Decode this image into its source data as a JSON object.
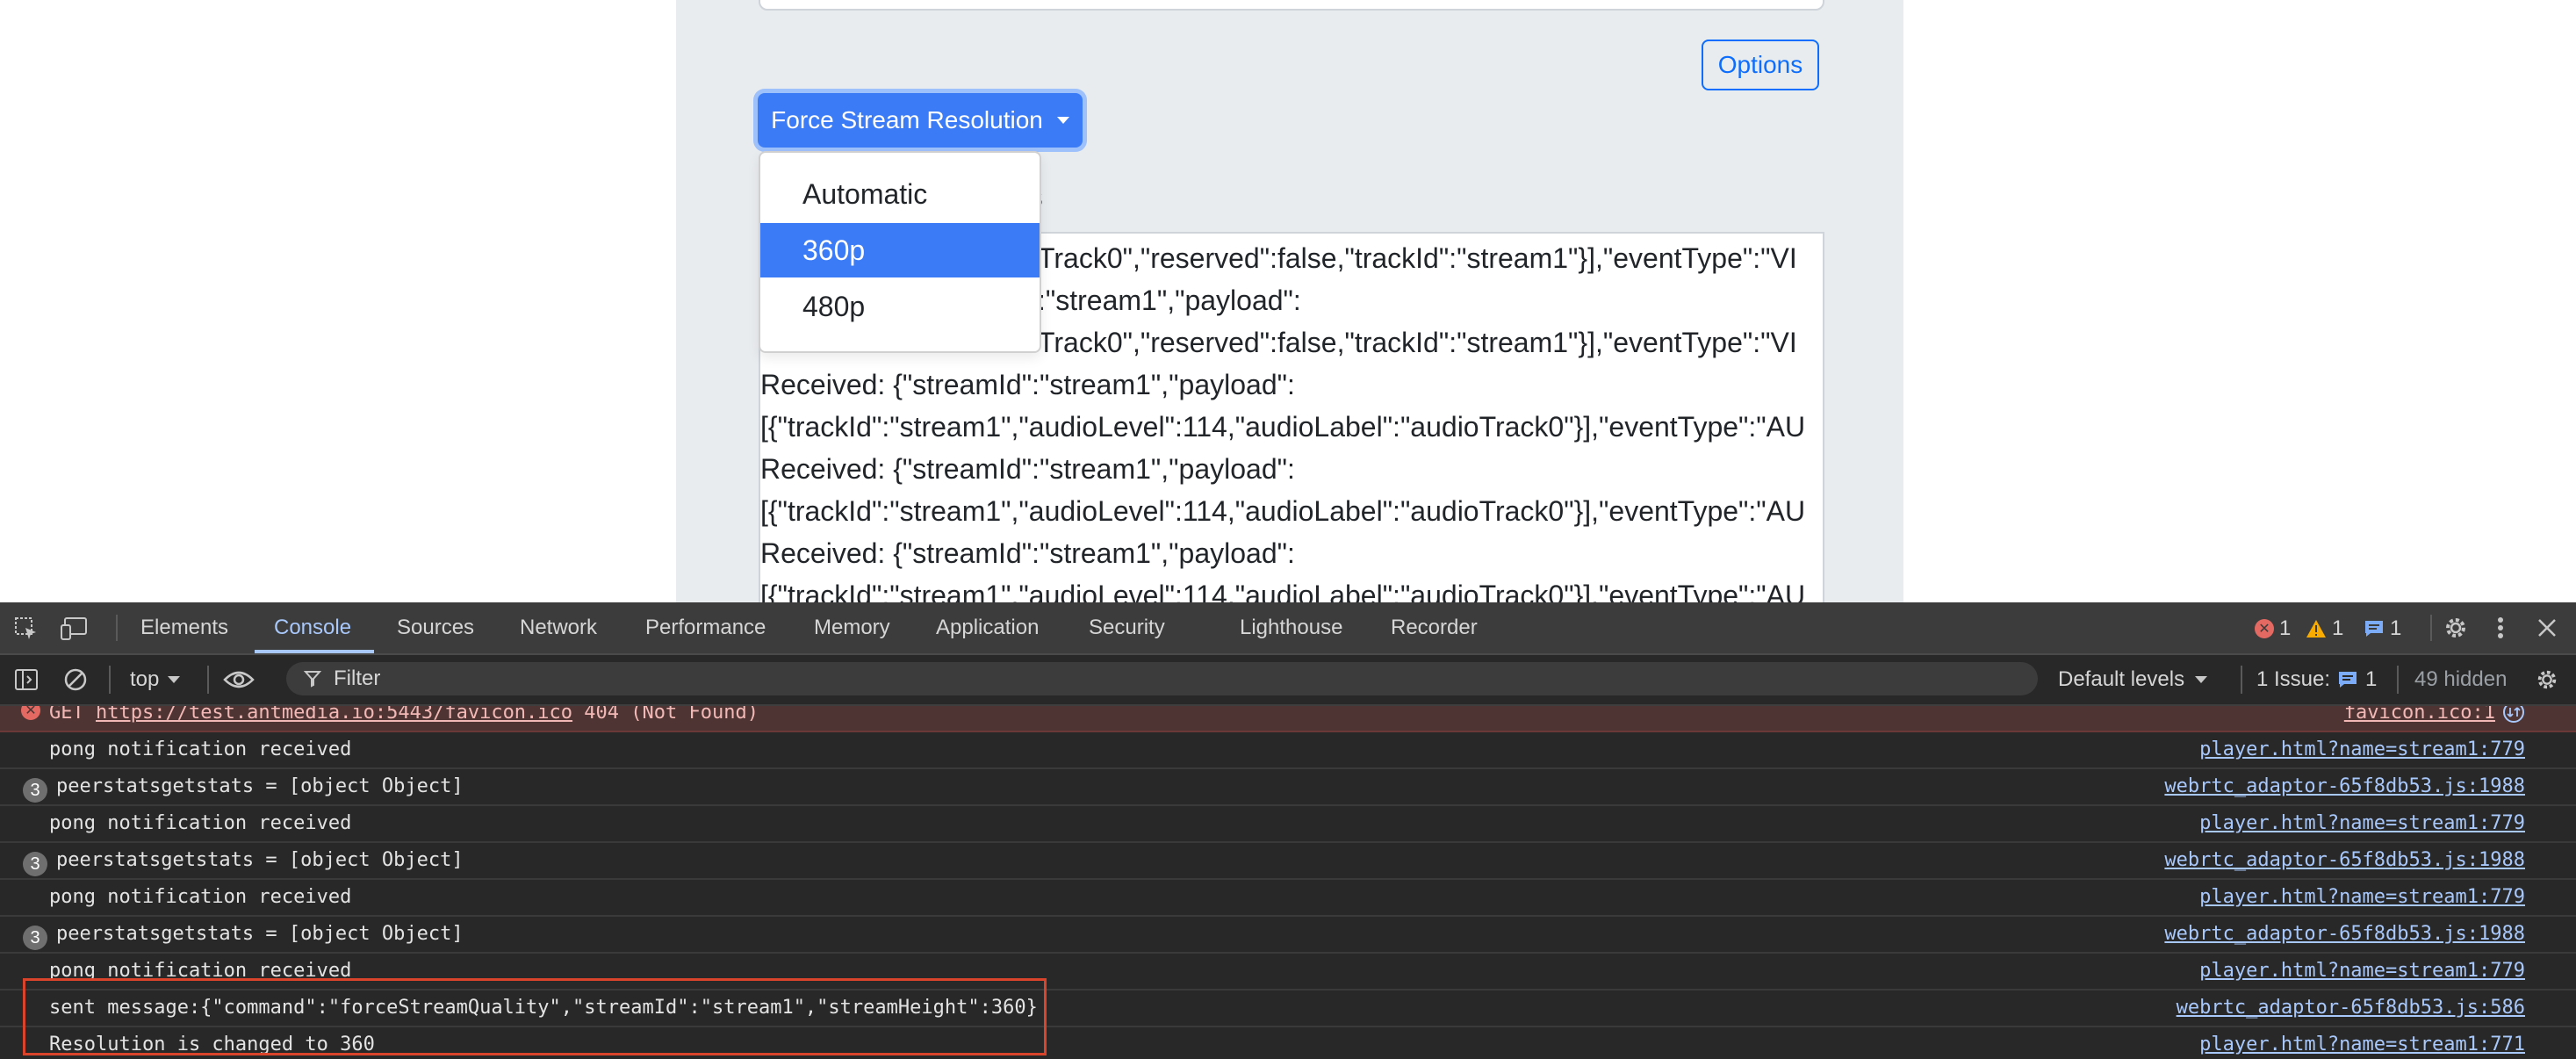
{
  "page": {
    "options_label": "Options",
    "force_button_label": "Force Stream Resolution",
    "section_label_fragment": "es",
    "dropdown": {
      "items": [
        "Automatic",
        "360p",
        "480p"
      ],
      "selected": "360p"
    },
    "log_lines": [
      "Track0\",\"reserved\":false,\"trackId\":\"stream1\"}],\"eventType\":\"VI",
      ":\"stream1\",\"payload\":",
      "Track0\",\"reserved\":false,\"trackId\":\"stream1\"}],\"eventType\":\"VI",
      "Received: {\"streamId\":\"stream1\",\"payload\":",
      "[{\"trackId\":\"stream1\",\"audioLevel\":114,\"audioLabel\":\"audioTrack0\"}],\"eventType\":\"AU",
      "Received: {\"streamId\":\"stream1\",\"payload\":",
      "[{\"trackId\":\"stream1\",\"audioLevel\":114,\"audioLabel\":\"audioTrack0\"}],\"eventType\":\"AU",
      "Received: {\"streamId\":\"stream1\",\"payload\":",
      "[{\"trackId\":\"stream1\",\"audioLevel\":114,\"audioLabel\":\"audioTrack0\"}],\"eventType\":\"AU"
    ]
  },
  "devtools": {
    "tabs": [
      "Elements",
      "Console",
      "Sources",
      "Network",
      "Performance",
      "Memory",
      "Application",
      "Security",
      "Lighthouse",
      "Recorder"
    ],
    "active_tab": "Console",
    "counts": {
      "errors": "1",
      "warnings": "1",
      "messages": "1"
    },
    "toolbar": {
      "context": "top",
      "filter_placeholder": "Filter",
      "levels": "Default levels",
      "issues_label": "1 Issue:",
      "issues_count": "1",
      "hidden": "49 hidden"
    },
    "console_rows": [
      {
        "type": "error",
        "msg_prefix": "GET ",
        "msg_link": "https://test.antmedia.io:5443/favicon.ico",
        "msg_suffix": " 404 (Not Found)",
        "source": "favicon.ico:1"
      },
      {
        "type": "log",
        "msg": "pong notification received",
        "source": "player.html?name=stream1:779"
      },
      {
        "type": "grouped",
        "count": "3",
        "msg": "peerstatsgetstats = [object Object]",
        "source": "webrtc_adaptor-65f8db53.js:1988"
      },
      {
        "type": "log",
        "msg": "pong notification received",
        "source": "player.html?name=stream1:779"
      },
      {
        "type": "grouped",
        "count": "3",
        "msg": "peerstatsgetstats = [object Object]",
        "source": "webrtc_adaptor-65f8db53.js:1988"
      },
      {
        "type": "log",
        "msg": "pong notification received",
        "source": "player.html?name=stream1:779"
      },
      {
        "type": "grouped",
        "count": "3",
        "msg": "peerstatsgetstats = [object Object]",
        "source": "webrtc_adaptor-65f8db53.js:1988"
      },
      {
        "type": "log",
        "msg": "pong notification received",
        "source": "player.html?name=stream1:779"
      },
      {
        "type": "log",
        "msg": "sent message:{\"command\":\"forceStreamQuality\",\"streamId\":\"stream1\",\"streamHeight\":360}",
        "source": "webrtc_adaptor-65f8db53.js:586"
      },
      {
        "type": "log",
        "msg": "Resolution is changed to 360",
        "source": "player.html?name=stream1:771"
      }
    ],
    "highlight_color": "#d9442b"
  }
}
